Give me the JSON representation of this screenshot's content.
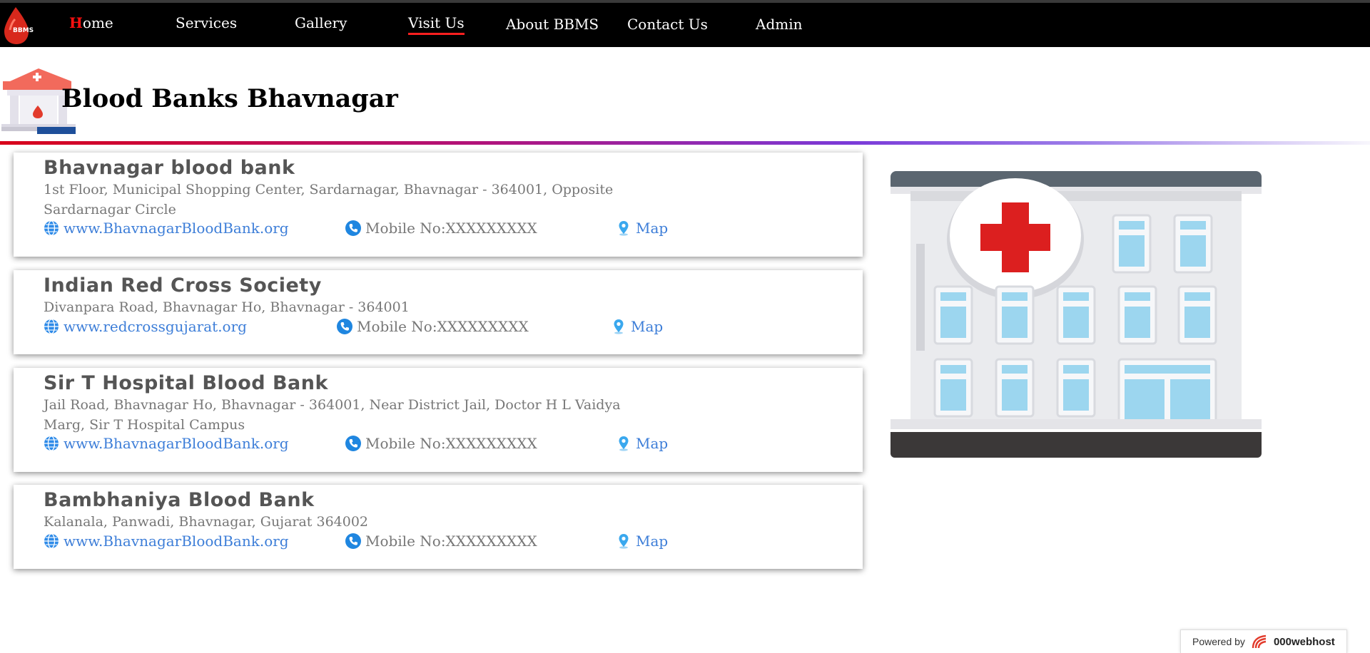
{
  "nav": {
    "logo_text": "BBMS",
    "items": [
      {
        "first": "H",
        "rest": "ome"
      },
      {
        "label": "Services"
      },
      {
        "label": "Gallery"
      },
      {
        "label": "Visit Us"
      },
      {
        "label": "About BBMS"
      },
      {
        "label": "Contact Us"
      },
      {
        "label": "Admin"
      }
    ],
    "active": "Visit Us"
  },
  "header": {
    "title": "Blood Banks Bhavnagar"
  },
  "banks": [
    {
      "name": "Bhavnagar blood bank",
      "address": "1st Floor, Municipal Shopping Center, Sardarnagar, Bhavnagar - 364001, Opposite Sardarnagar Circle",
      "website": "www.BhavnagarBloodBank.org",
      "phone": "Mobile No:XXXXXXXXX",
      "map": "Map"
    },
    {
      "name": "Indian Red Cross Society",
      "address": "Divanpara Road, Bhavnagar Ho, Bhavnagar - 364001",
      "website": "www.redcrossgujarat.org",
      "phone": "Mobile No:XXXXXXXXX",
      "map": "Map"
    },
    {
      "name": "Sir T Hospital Blood Bank",
      "address": "Jail Road, Bhavnagar Ho, Bhavnagar - 364001, Near District Jail, Doctor H L Vaidya Marg, Sir T Hospital Campus",
      "website": "www.BhavnagarBloodBank.org",
      "phone": "Mobile No:XXXXXXXXX",
      "map": "Map"
    },
    {
      "name": "Bambhaniya Blood Bank",
      "address": "Kalanala, Panwadi, Bhavnagar, Gujarat 364002",
      "website": "www.BhavnagarBloodBank.org",
      "phone": "Mobile No:XXXXXXXXX",
      "map": "Map"
    }
  ],
  "footer": {
    "powered_by": "Powered by",
    "host": "000webhost"
  },
  "icons": {
    "website": "globe-icon",
    "phone": "phone-icon",
    "map": "map-pin-icon"
  },
  "colors": {
    "nav_bg": "#000000",
    "accent_red": "#ff1010",
    "link_blue": "#3d7ed8",
    "text_gray": "#777777"
  }
}
